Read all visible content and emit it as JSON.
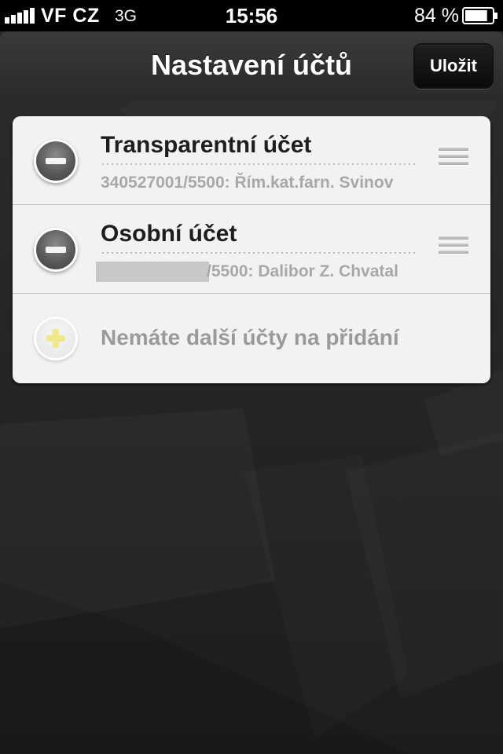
{
  "status_bar": {
    "carrier": "VF CZ",
    "network": "3G",
    "time": "15:56",
    "battery": "84 %",
    "battery_level": 0.84
  },
  "nav": {
    "title": "Nastavení účtů",
    "save_label": "Uložit"
  },
  "accounts": [
    {
      "name": "Transparentní účet",
      "detail": "340527001/5500: Řím.kat.farn. Svinov"
    },
    {
      "name": "Osobní účet",
      "detail": "/5500: Dalibor Z. Chvatal"
    }
  ],
  "add_row": {
    "label": "Nemáte další účty na přidání"
  },
  "colors": {
    "accent_plus": "#efe98a",
    "card_bg": "#f2f2f2",
    "app_bg": "#262626"
  }
}
